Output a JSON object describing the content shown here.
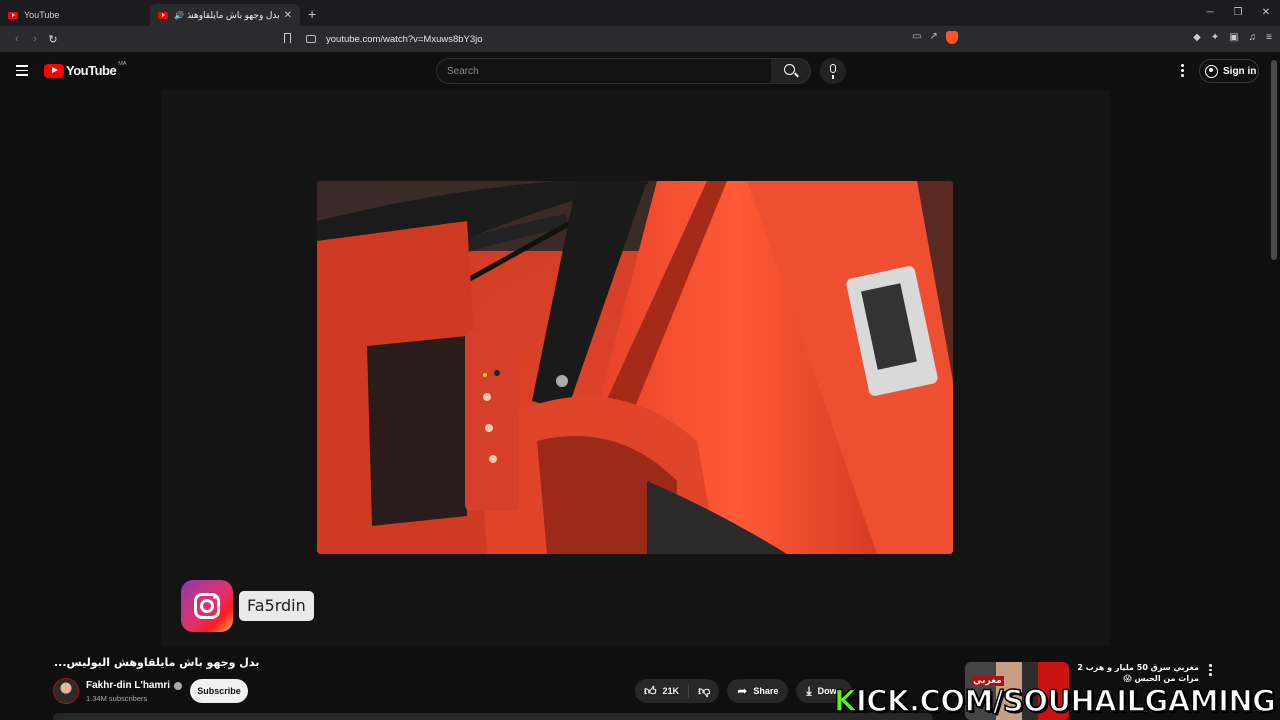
{
  "browser": {
    "tabs": [
      {
        "label": "YouTube",
        "active": false
      },
      {
        "label": "بدل وجهو باش مايلقاوهش البو...",
        "active": true
      }
    ],
    "url": "youtube.com/watch?v=Mxuws8bY3jo"
  },
  "youtube": {
    "logo_text": "YouTube",
    "region": "MA",
    "search_placeholder": "Search",
    "sign_in": "Sign in"
  },
  "video": {
    "title": "بدل وجهو باش مايلقاوهش البوليس...",
    "overlay_handle": "Fa5rdin",
    "channel": {
      "name": "Fakhr-din L'hamri",
      "subscribers": "1.34M subscribers",
      "subscribe_label": "Subscribe"
    },
    "actions": {
      "likes": "21K",
      "share": "Share",
      "download": "Down"
    }
  },
  "recommendation": {
    "title": "مغربي سرق 50 مليار و هرب 2 مرات من الحبس 😱",
    "thumb_caption": "مغربي"
  },
  "stream_overlay": {
    "text_first": "K",
    "text_rest": "ICK.COM/SOUHAILGAMING"
  },
  "colors": {
    "brand_red": "#ff0000",
    "kick_green": "#53fc18",
    "background": "#0f0f0f"
  }
}
